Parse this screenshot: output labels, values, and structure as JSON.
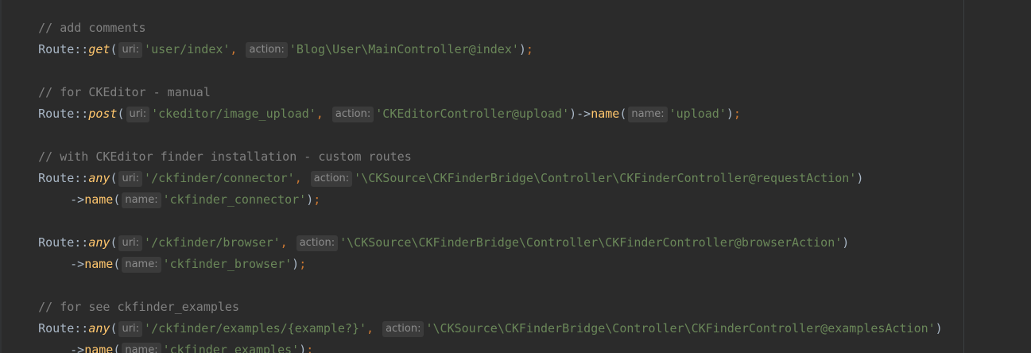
{
  "lines": [
    {
      "comment": "// add comments"
    },
    {
      "cls": "Route",
      "op": "::",
      "method": "get",
      "open": "(",
      "hint1": "uri:",
      "arg1": "'user/index'",
      "sep": ", ",
      "hint2": "action:",
      "arg2": "'Blog\\User\\MainController@index'",
      "close": ")",
      "semi": ";"
    },
    {
      "comment": "// for CKEditor - manual"
    },
    {
      "cls": "Route",
      "op": "::",
      "method": "post",
      "open": "(",
      "hint1": "uri:",
      "arg1": "'ckeditor/image_upload'",
      "sep": ", ",
      "hint2": "action:",
      "arg2": "'CKEditorController@upload'",
      "close": ")",
      "arrow": "->",
      "chain": "name",
      "open2": "(",
      "hint3": "name:",
      "arg3": "'upload'",
      "close2": ")",
      "semi": ";"
    },
    {
      "comment": "// with CKEditor finder installation - custom routes"
    },
    {
      "cls": "Route",
      "op": "::",
      "method": "any",
      "open": "(",
      "hint1": "uri:",
      "arg1": "'/ckfinder/connector'",
      "sep": ", ",
      "hint2": "action:",
      "arg2": "'\\CKSource\\CKFinderBridge\\Controller\\CKFinderController@requestAction'",
      "close": ")"
    },
    {
      "arrow": "->",
      "chain": "name",
      "open2": "(",
      "hint3": "name:",
      "arg3": "'ckfinder_connector'",
      "close2": ")",
      "semi": ";"
    },
    {
      "cls": "Route",
      "op": "::",
      "method": "any",
      "open": "(",
      "hint1": "uri:",
      "arg1": "'/ckfinder/browser'",
      "sep": ", ",
      "hint2": "action:",
      "arg2": "'\\CKSource\\CKFinderBridge\\Controller\\CKFinderController@browserAction'",
      "close": ")"
    },
    {
      "arrow": "->",
      "chain": "name",
      "open2": "(",
      "hint3": "name:",
      "arg3": "'ckfinder_browser'",
      "close2": ")",
      "semi": ";"
    },
    {
      "comment": "// for see ckfinder_examples"
    },
    {
      "cls": "Route",
      "op": "::",
      "method": "any",
      "open": "(",
      "hint1": "uri:",
      "arg1": "'/ckfinder/examples/{example?}'",
      "sep": ", ",
      "hint2": "action:",
      "arg2": "'\\CKSource\\CKFinderBridge\\Controller\\CKFinderController@examplesAction'",
      "close": ")"
    },
    {
      "arrow": "->",
      "chain": "name",
      "open2": "(",
      "hint3": "name:",
      "arg3": "'ckfinder_examples'",
      "close2": ")",
      "semi": ";"
    }
  ],
  "colors": {
    "background": "#2b2b2b",
    "text": "#a9b7c6",
    "comment": "#808080",
    "method": "#ffc66d",
    "string": "#6a8759",
    "keyword": "#cc7832",
    "hint_bg": "#3b3b3b",
    "hint_text": "#8c8c8c"
  }
}
